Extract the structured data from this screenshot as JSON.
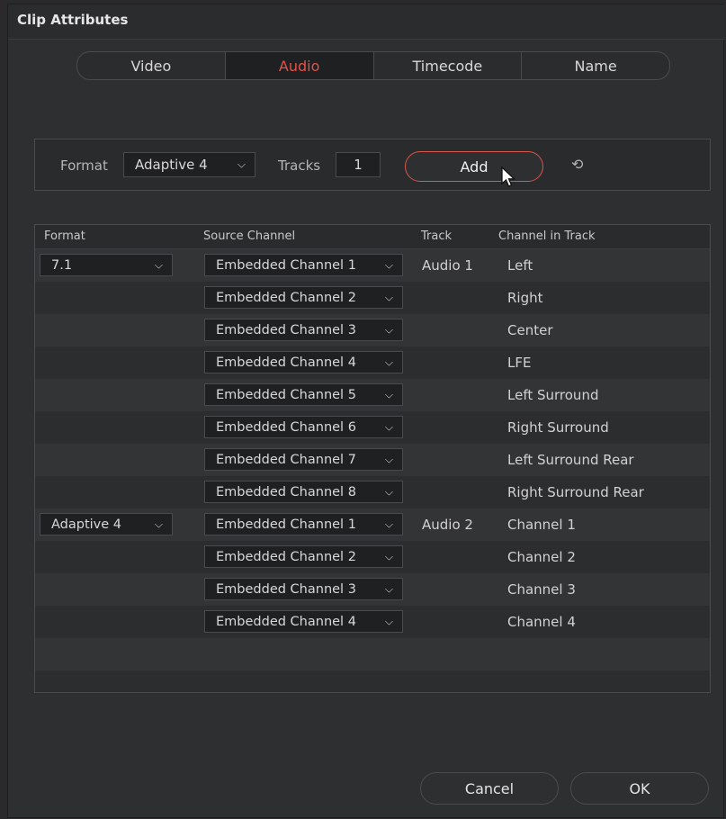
{
  "window": {
    "title": "Clip Attributes"
  },
  "tabs": [
    {
      "label": "Video"
    },
    {
      "label": "Audio"
    },
    {
      "label": "Timecode"
    },
    {
      "label": "Name"
    }
  ],
  "add_bar": {
    "format_label": "Format",
    "format_value": "Adaptive 4",
    "tracks_label": "Tracks",
    "tracks_value": "1",
    "add_label": "Add"
  },
  "table": {
    "headers": [
      "Format",
      "Source Channel",
      "Track",
      "Channel in Track"
    ],
    "rows": [
      {
        "format": "7.1",
        "source": "Embedded Channel 1",
        "track": "Audio 1",
        "channel": "Left"
      },
      {
        "format": "",
        "source": "Embedded Channel 2",
        "track": "",
        "channel": "Right"
      },
      {
        "format": "",
        "source": "Embedded Channel 3",
        "track": "",
        "channel": "Center"
      },
      {
        "format": "",
        "source": "Embedded Channel 4",
        "track": "",
        "channel": "LFE"
      },
      {
        "format": "",
        "source": "Embedded Channel 5",
        "track": "",
        "channel": "Left Surround"
      },
      {
        "format": "",
        "source": "Embedded Channel 6",
        "track": "",
        "channel": "Right Surround"
      },
      {
        "format": "",
        "source": "Embedded Channel 7",
        "track": "",
        "channel": "Left Surround Rear"
      },
      {
        "format": "",
        "source": "Embedded Channel 8",
        "track": "",
        "channel": "Right Surround Rear"
      },
      {
        "format": "Adaptive 4",
        "source": "Embedded Channel 1",
        "track": "Audio 2",
        "channel": "Channel 1"
      },
      {
        "format": "",
        "source": "Embedded Channel 2",
        "track": "",
        "channel": "Channel 2"
      },
      {
        "format": "",
        "source": "Embedded Channel 3",
        "track": "",
        "channel": "Channel 3"
      },
      {
        "format": "",
        "source": "Embedded Channel 4",
        "track": "",
        "channel": "Channel 4"
      }
    ]
  },
  "footer": {
    "cancel_label": "Cancel",
    "ok_label": "OK"
  },
  "colors": {
    "accent": "#e3524a",
    "background": "#2e2f31"
  }
}
